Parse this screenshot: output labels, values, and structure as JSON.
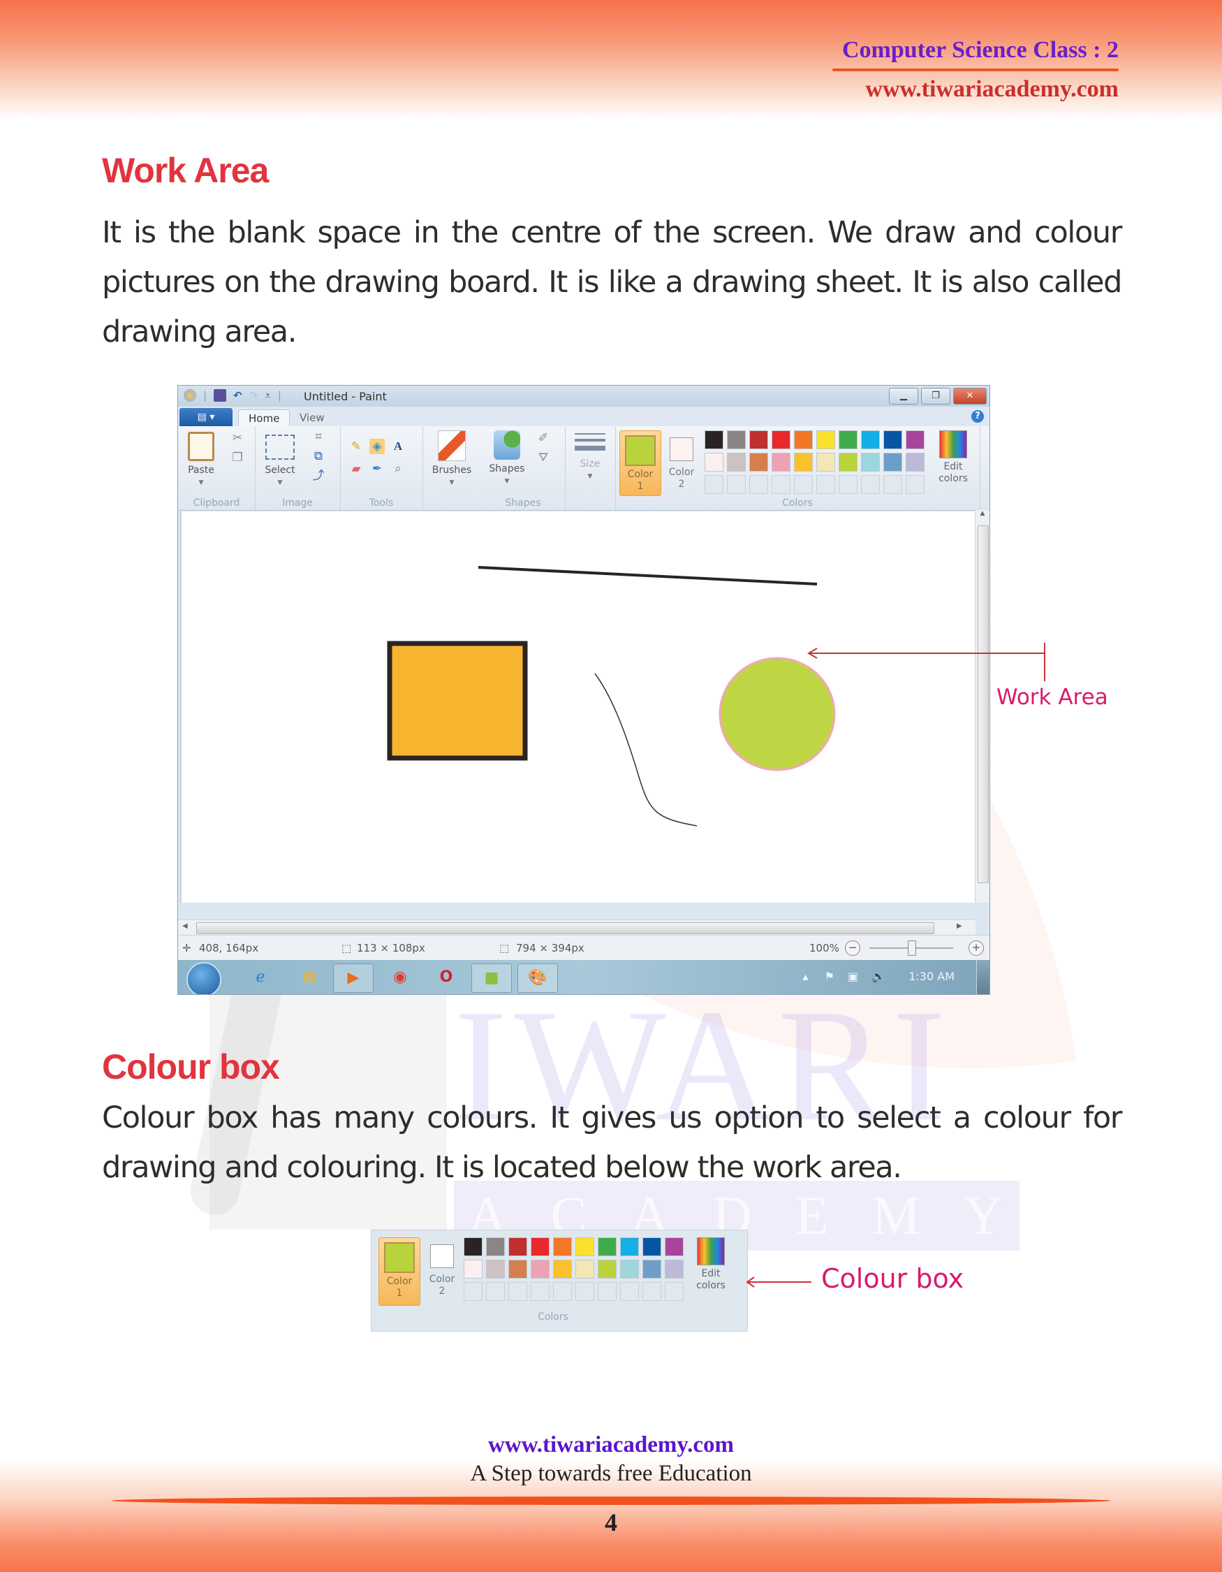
{
  "header": {
    "class_label": "Computer Science Class : 2",
    "website": "www.tiwariacademy.com"
  },
  "watermark": {
    "text": "IWARI",
    "subtext": "ACADEMY"
  },
  "sections": [
    {
      "heading": "Work Area",
      "body": "It is the blank space in the centre of the screen. We draw and colour pictures on the drawing board. It is like a drawing sheet. It is also called drawing area."
    },
    {
      "heading": "Colour box",
      "body": "Colour box has many colours. It gives us option to select a colour for drawing and colouring. It is located below the work area."
    }
  ],
  "paint_window": {
    "title": "Untitled - Paint",
    "tabs": [
      {
        "label": "Home",
        "active": true
      },
      {
        "label": "View",
        "active": false
      }
    ],
    "help_label": "?",
    "groups": {
      "clipboard": {
        "label": "Clipboard",
        "paste_label": "Paste"
      },
      "image": {
        "label": "Image",
        "select_label": "Select"
      },
      "tools": {
        "label": "Tools"
      },
      "brushes": {
        "label": "Brushes"
      },
      "shapes": {
        "label": "Shapes",
        "button_label": "Shapes"
      },
      "size": {
        "label": "Size"
      },
      "colors": {
        "label": "Colors",
        "color1_label": "Color",
        "color1_num": "1",
        "color1_value": "#b9d33c",
        "color2_label": "Color",
        "color2_num": "2",
        "color2_value": "#fdf2f2",
        "edit_label_1": "Edit",
        "edit_label_2": "colors",
        "palette_row1": [
          "#2b2323",
          "#8c8585",
          "#c0302f",
          "#e8282a",
          "#f27727",
          "#fbe02c",
          "#3fab4a",
          "#14aee8",
          "#0955a5",
          "#a7459c"
        ],
        "palette_row2": [
          "#fdeeef",
          "#cdc2c2",
          "#d77e4f",
          "#eda1b5",
          "#f9c12c",
          "#f4e6b5",
          "#b9d33c",
          "#9dd6dc",
          "#6c9ec9",
          "#bcbad8"
        ],
        "palette_row3_empty_count": 10
      }
    },
    "canvas": {
      "shapes": [
        {
          "type": "line",
          "stroke": "#2b2323"
        },
        {
          "type": "rectangle",
          "fill": "#f7b52f",
          "stroke": "#2b2323"
        },
        {
          "type": "freehand",
          "stroke": "#333333"
        },
        {
          "type": "ellipse",
          "fill": "#bfd644",
          "stroke": "#f0a8b8"
        }
      ]
    },
    "status": {
      "cursor_pos": "408, 164px",
      "selection_size": "113 × 108px",
      "image_size": "794 × 394px",
      "zoom": "100%",
      "zoom_level_pct": 50
    },
    "taskbar": {
      "apps": [
        "start-orb",
        "internet-explorer",
        "file-explorer",
        "media-player",
        "chrome",
        "opera",
        "greenshot",
        "paint"
      ],
      "clock": "1:30 AM"
    }
  },
  "annotations": {
    "work_area": "Work Area",
    "colour_box": "Colour box"
  },
  "footer": {
    "website": "www.tiwariacademy.com",
    "tagline": "A Step towards free Education",
    "page_number": "4"
  }
}
